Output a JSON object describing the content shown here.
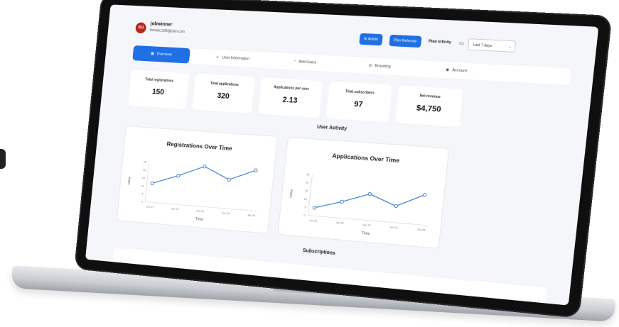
{
  "header": {
    "avatar_initials": "SU",
    "username": "jobwinner",
    "email": "itsmalo1199@jobin.com",
    "admin_label": "Admin",
    "plan_refer_label": "Plan Referrals",
    "plan_label": "Plan Infinity",
    "date_range": "Last 7 days"
  },
  "tabs": [
    {
      "label": "Overview",
      "icon": "grid-icon",
      "active": true
    },
    {
      "label": "User Information",
      "icon": "users-icon",
      "active": false
    },
    {
      "label": "Add Users",
      "icon": "add-user-icon",
      "active": false
    },
    {
      "label": "Branding",
      "icon": "palette-icon",
      "active": false
    },
    {
      "label": "Account",
      "icon": "account-icon",
      "active": false
    }
  ],
  "stats": [
    {
      "label": "Total registrations",
      "value": "150"
    },
    {
      "label": "Total applications",
      "value": "320"
    },
    {
      "label": "Applications per user",
      "value": "2.13"
    },
    {
      "label": "Total subscribers",
      "value": "97"
    },
    {
      "label": "Net revenue",
      "value": "$4,750"
    }
  ],
  "sections": {
    "user_activity": "User Activity",
    "subscriptions": "Subscriptions"
  },
  "chart_data": [
    {
      "type": "line",
      "title": "Registrations Over Time",
      "xlabel": "Time",
      "ylabel": "Value",
      "categories": [
        "Jun 21",
        "Jun 22",
        "Jun 23",
        "Jun 24",
        "Jun 25"
      ],
      "values": [
        12,
        18,
        25,
        18,
        27
      ],
      "ylim": [
        0,
        25
      ],
      "yticks": [
        "0",
        "5",
        "10",
        "15",
        "20",
        "25"
      ]
    },
    {
      "type": "line",
      "title": "Applications Over Time",
      "xlabel": "Time",
      "ylabel": "Value",
      "categories": [
        "Jun 21",
        "Jun 22",
        "Jun 23",
        "Jun 24",
        "Jun 25"
      ],
      "values": [
        5,
        10,
        16,
        10,
        18
      ],
      "ylim": [
        0,
        25
      ],
      "yticks": [
        "0",
        "5",
        "10",
        "15",
        "20",
        "25"
      ]
    }
  ],
  "colors": {
    "accent": "#1f6fe5",
    "line": "#3b7dd8",
    "avatar": "#b3261e"
  }
}
